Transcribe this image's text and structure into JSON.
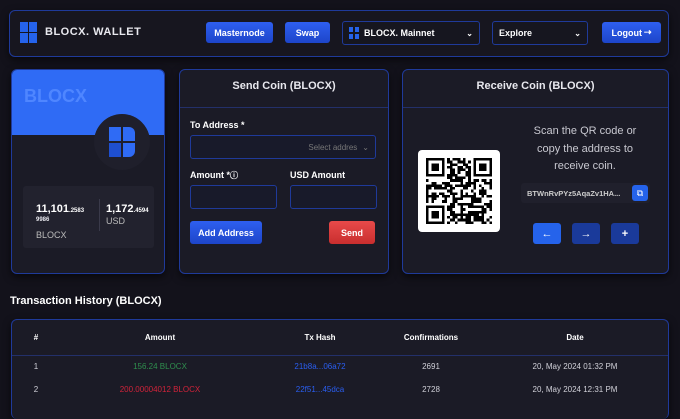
{
  "header": {
    "brand": "BLOCX. WALLET",
    "masternode": "Masternode",
    "swap": "Swap",
    "network": "BLOCX. Mainnet",
    "explore": "Explore",
    "logout": "Logout",
    "logout_icon": "logout-icon"
  },
  "balance_card": {
    "coin": "BLOCX",
    "blocx_int": "11,101",
    "blocx_dec": ".2583",
    "blocx_dec2": "9986",
    "blocx_unit": "BLOCX",
    "usd_int": "1,172",
    "usd_dec": ".4594",
    "usd_unit": "USD"
  },
  "send": {
    "title": "Send Coin (BLOCX)",
    "to_label": "To Address *",
    "to_placeholder": "Select addres",
    "amount_label": "Amount *",
    "usd_label": "USD Amount",
    "add_address": "Add Address",
    "send": "Send"
  },
  "receive": {
    "title": "Receive Coin (BLOCX)",
    "instructions": "Scan the QR code or copy the address to receive coin.",
    "address": "BTWnRvPYz5AqaZv1HA..."
  },
  "history": {
    "title": "Transaction History (BLOCX)",
    "columns": [
      "#",
      "Amount",
      "Tx Hash",
      "Confirmations",
      "Date"
    ],
    "rows": [
      {
        "n": "1",
        "amount": "156.24 BLOCX",
        "type": "in",
        "hash": "21b8a...06a72",
        "conf": "2691",
        "date": "20, May 2024 01:32 PM"
      },
      {
        "n": "2",
        "amount": "200.00004012 BLOCX",
        "type": "out",
        "hash": "22f51...45dca",
        "conf": "2728",
        "date": "20, May 2024 12:31 PM"
      }
    ]
  },
  "colors": {
    "accent": "#2563eb",
    "in": "#2f8f4e",
    "out": "#d0233a",
    "send": "#d63a3a"
  }
}
